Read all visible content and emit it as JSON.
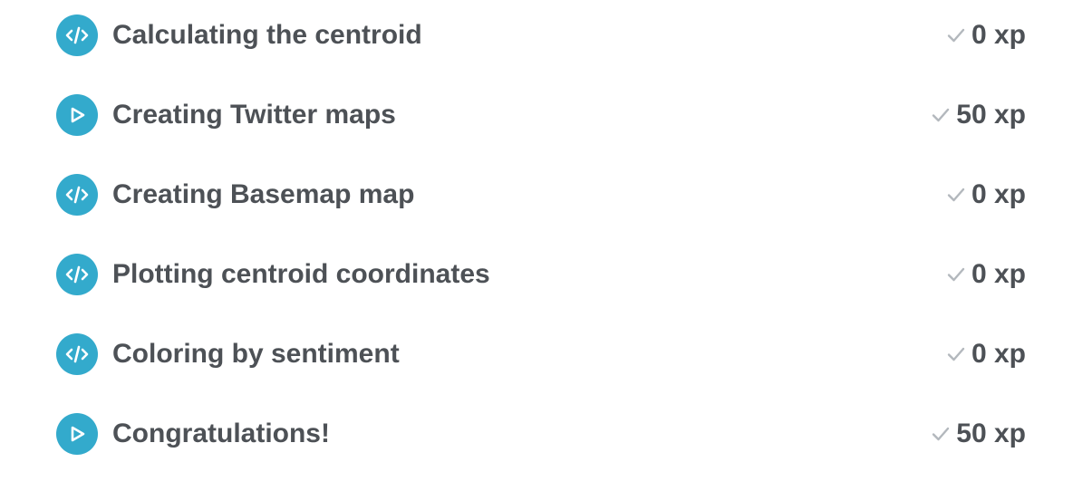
{
  "colors": {
    "icon_background": "#33aacc",
    "text": "#4d5156",
    "check": "#b3b8bd"
  },
  "exercises": [
    {
      "type": "code",
      "icon": "code-icon",
      "title": "Calculating the centroid",
      "xp": "0 xp",
      "completed_icon": "checkmark-icon"
    },
    {
      "type": "video",
      "icon": "play-icon",
      "title": "Creating Twitter maps",
      "xp": "50 xp",
      "completed_icon": "checkmark-icon"
    },
    {
      "type": "code",
      "icon": "code-icon",
      "title": "Creating Basemap map",
      "xp": "0 xp",
      "completed_icon": "checkmark-icon"
    },
    {
      "type": "code",
      "icon": "code-icon",
      "title": "Plotting centroid coordinates",
      "xp": "0 xp",
      "completed_icon": "checkmark-icon"
    },
    {
      "type": "code",
      "icon": "code-icon",
      "title": "Coloring by sentiment",
      "xp": "0 xp",
      "completed_icon": "checkmark-icon"
    },
    {
      "type": "video",
      "icon": "play-icon",
      "title": "Congratulations!",
      "xp": "50 xp",
      "completed_icon": "checkmark-icon"
    }
  ]
}
